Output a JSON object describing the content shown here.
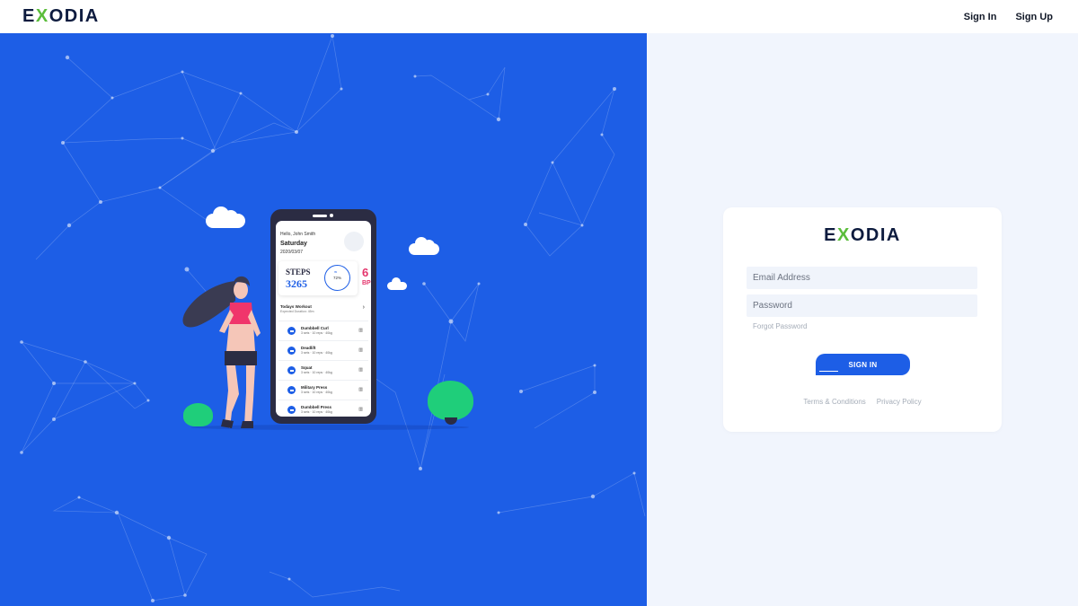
{
  "brand": {
    "logo_pre": "E",
    "logo_x": "X",
    "logo_post": "ODIA"
  },
  "nav": {
    "sign_in": "Sign In",
    "sign_up": "Sign Up"
  },
  "login": {
    "email_placeholder": "Email Address",
    "password_placeholder": "Password",
    "forgot": "Forgot Password",
    "submit": "SIGN IN",
    "terms": "Terms & Conditions",
    "privacy": "Privacy Policy"
  },
  "app_preview": {
    "greeting": "Hello, John Smith",
    "day": "Saturday",
    "date": "2020/03/07",
    "steps_label": "STEPS",
    "steps_value": "3265",
    "progress_label": "72%",
    "bpm_value": "6",
    "bpm_label": "BP",
    "workout_title": "Todays Workout",
    "workout_expected": "Expected Duration: 45m",
    "exercises": [
      {
        "name": "Dumbbell Curl",
        "sets": "3 sets",
        "reps": "10 reps",
        "weight": "40kg"
      },
      {
        "name": "Deadlift",
        "sets": "3 sets",
        "reps": "10 reps",
        "weight": "40kg"
      },
      {
        "name": "Squat",
        "sets": "3 sets",
        "reps": "10 reps",
        "weight": "40kg"
      },
      {
        "name": "Military Press",
        "sets": "3 sets",
        "reps": "10 reps",
        "weight": "40kg"
      },
      {
        "name": "Dumbbell Press",
        "sets": "3 sets",
        "reps": "10 reps",
        "weight": "40kg"
      }
    ]
  },
  "colors": {
    "brand_blue": "#1d5ee6",
    "brand_navy": "#0d1b3e",
    "logo_accent": "#5bbd3b",
    "bpm_pink": "#e4346c"
  }
}
